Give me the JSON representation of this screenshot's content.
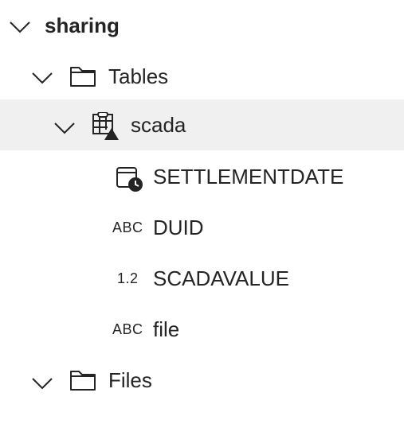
{
  "tree": {
    "root": {
      "label": "sharing",
      "expanded": true,
      "icon": "chevron-down-icon"
    },
    "tables_folder": {
      "label": "Tables",
      "expanded": true,
      "icon": "folder-icon"
    },
    "table": {
      "label": "scada",
      "expanded": true,
      "icon": "table-warning-icon",
      "selected": true
    },
    "columns": [
      {
        "label": "SETTLEMENTDATE",
        "type_icon": "datetime-icon",
        "type_text": ""
      },
      {
        "label": "DUID",
        "type_icon": "string-type-icon",
        "type_text": "ABC"
      },
      {
        "label": "SCADAVALUE",
        "type_icon": "number-type-icon",
        "type_text": "1.2"
      },
      {
        "label": "file",
        "type_icon": "string-type-icon",
        "type_text": "ABC"
      }
    ],
    "files_folder": {
      "label": "Files",
      "expanded": true,
      "icon": "folder-icon"
    }
  },
  "colors": {
    "selected_row_bg": "#f0f0f0",
    "text": "#242424",
    "icon": "#242424"
  }
}
